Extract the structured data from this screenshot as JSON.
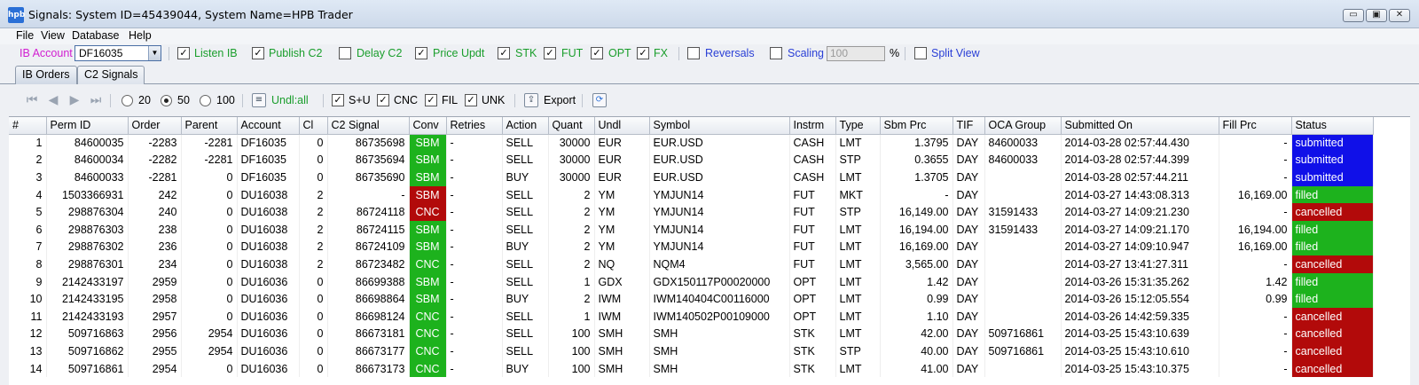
{
  "window": {
    "icon_text": "hpb",
    "title": "Signals: System ID=45439044, System Name=HPB Trader",
    "btn_min": "▭",
    "btn_max": "▣",
    "btn_close": "✕"
  },
  "menu": [
    "File",
    "View",
    "Database",
    "Help"
  ],
  "toolbar": {
    "ib_account_label": "IB Account",
    "ib_account_value": "DF16035",
    "listen_ib": "Listen IB",
    "publish_c2": "Publish C2",
    "delay_c2": "Delay C2",
    "price_updt": "Price Updt",
    "stk": "STK",
    "fut": "FUT",
    "opt": "OPT",
    "fx": "FX",
    "reversals": "Reversals",
    "scaling": "Scaling",
    "scaling_value": "100",
    "percent": "%",
    "split_view": "Split View",
    "check_mark": "✓"
  },
  "tabs": [
    "IB Orders",
    "C2 Signals"
  ],
  "subtoolbar": {
    "r20": "20",
    "r50": "50",
    "r100": "100",
    "undl": "Undl:all",
    "su": "S+U",
    "cnc": "CNC",
    "fil": "FIL",
    "unk": "UNK",
    "export": "Export"
  },
  "table": {
    "columns": [
      "#",
      "Perm ID",
      "Order",
      "Parent",
      "Account",
      "Cl",
      "C2 Signal",
      "Conv",
      "Retries",
      "Action",
      "Quant",
      "Undl",
      "Symbol",
      "Instrm",
      "Type",
      "Sbm Prc",
      "TIF",
      "OCA Group",
      "Submitted On",
      "Fill Prc",
      "Status"
    ],
    "rows": [
      [
        "1",
        "84600035",
        "-2283",
        "-2281",
        "DF16035",
        "0",
        "86735698",
        "SBM",
        "-",
        "SELL",
        "30000",
        "EUR",
        "EUR.USD",
        "CASH",
        "LMT",
        "1.3795",
        "DAY",
        "84600033",
        "2014-03-28 02:57:44.430",
        "-",
        "submitted"
      ],
      [
        "2",
        "84600034",
        "-2282",
        "-2281",
        "DF16035",
        "0",
        "86735694",
        "SBM",
        "-",
        "SELL",
        "30000",
        "EUR",
        "EUR.USD",
        "CASH",
        "STP",
        "0.3655",
        "DAY",
        "84600033",
        "2014-03-28 02:57:44.399",
        "-",
        "submitted"
      ],
      [
        "3",
        "84600033",
        "-2281",
        "0",
        "DF16035",
        "0",
        "86735690",
        "SBM",
        "-",
        "BUY",
        "30000",
        "EUR",
        "EUR.USD",
        "CASH",
        "LMT",
        "1.3705",
        "DAY",
        "",
        "2014-03-28 02:57:44.211",
        "-",
        "submitted"
      ],
      [
        "4",
        "1503366931",
        "242",
        "0",
        "DU16038",
        "2",
        "-",
        "SBM",
        "-",
        "SELL",
        "2",
        "YM",
        "YMJUN14",
        "FUT",
        "MKT",
        "-",
        "DAY",
        "",
        "2014-03-27 14:43:08.313",
        "16,169.00",
        "filled"
      ],
      [
        "5",
        "298876304",
        "240",
        "0",
        "DU16038",
        "2",
        "86724118",
        "CNC",
        "-",
        "SELL",
        "2",
        "YM",
        "YMJUN14",
        "FUT",
        "STP",
        "16,149.00",
        "DAY",
        "31591433",
        "2014-03-27 14:09:21.230",
        "-",
        "cancelled"
      ],
      [
        "6",
        "298876303",
        "238",
        "0",
        "DU16038",
        "2",
        "86724115",
        "SBM",
        "-",
        "SELL",
        "2",
        "YM",
        "YMJUN14",
        "FUT",
        "LMT",
        "16,194.00",
        "DAY",
        "31591433",
        "2014-03-27 14:09:21.170",
        "16,194.00",
        "filled"
      ],
      [
        "7",
        "298876302",
        "236",
        "0",
        "DU16038",
        "2",
        "86724109",
        "SBM",
        "-",
        "BUY",
        "2",
        "YM",
        "YMJUN14",
        "FUT",
        "LMT",
        "16,169.00",
        "DAY",
        "",
        "2014-03-27 14:09:10.947",
        "16,169.00",
        "filled"
      ],
      [
        "8",
        "298876301",
        "234",
        "0",
        "DU16038",
        "2",
        "86723482",
        "CNC",
        "-",
        "SELL",
        "2",
        "NQ",
        "NQM4",
        "FUT",
        "LMT",
        "3,565.00",
        "DAY",
        "",
        "2014-03-27 13:41:27.311",
        "-",
        "cancelled"
      ],
      [
        "9",
        "2142433197",
        "2959",
        "0",
        "DU16036",
        "0",
        "86699388",
        "SBM",
        "-",
        "SELL",
        "1",
        "GDX",
        "GDX150117P00020000",
        "OPT",
        "LMT",
        "1.42",
        "DAY",
        "",
        "2014-03-26 15:31:35.262",
        "1.42",
        "filled"
      ],
      [
        "10",
        "2142433195",
        "2958",
        "0",
        "DU16036",
        "0",
        "86698864",
        "SBM",
        "-",
        "BUY",
        "2",
        "IWM",
        "IWM140404C00116000",
        "OPT",
        "LMT",
        "0.99",
        "DAY",
        "",
        "2014-03-26 15:12:05.554",
        "0.99",
        "filled"
      ],
      [
        "11",
        "2142433193",
        "2957",
        "0",
        "DU16036",
        "0",
        "86698124",
        "CNC",
        "-",
        "SELL",
        "1",
        "IWM",
        "IWM140502P00109000",
        "OPT",
        "LMT",
        "1.10",
        "DAY",
        "",
        "2014-03-26 14:42:59.335",
        "-",
        "cancelled"
      ],
      [
        "12",
        "509716863",
        "2956",
        "2954",
        "DU16036",
        "0",
        "86673181",
        "CNC",
        "-",
        "SELL",
        "100",
        "SMH",
        "SMH",
        "STK",
        "LMT",
        "42.00",
        "DAY",
        "509716861",
        "2014-03-25 15:43:10.639",
        "-",
        "cancelled"
      ],
      [
        "13",
        "509716862",
        "2955",
        "2954",
        "DU16036",
        "0",
        "86673177",
        "CNC",
        "-",
        "SELL",
        "100",
        "SMH",
        "SMH",
        "STK",
        "STP",
        "40.00",
        "DAY",
        "509716861",
        "2014-03-25 15:43:10.610",
        "-",
        "cancelled"
      ],
      [
        "14",
        "509716861",
        "2954",
        "0",
        "DU16036",
        "0",
        "86673173",
        "CNC",
        "-",
        "BUY",
        "100",
        "SMH",
        "SMH",
        "STK",
        "LMT",
        "41.00",
        "DAY",
        "",
        "2014-03-25 15:43:10.375",
        "-",
        "cancelled"
      ]
    ],
    "conv_red_rows": [
      3,
      4
    ]
  },
  "colors": {
    "submitted": "#1010e8",
    "filled": "#1db21d",
    "cancelled": "#b20a0a"
  }
}
